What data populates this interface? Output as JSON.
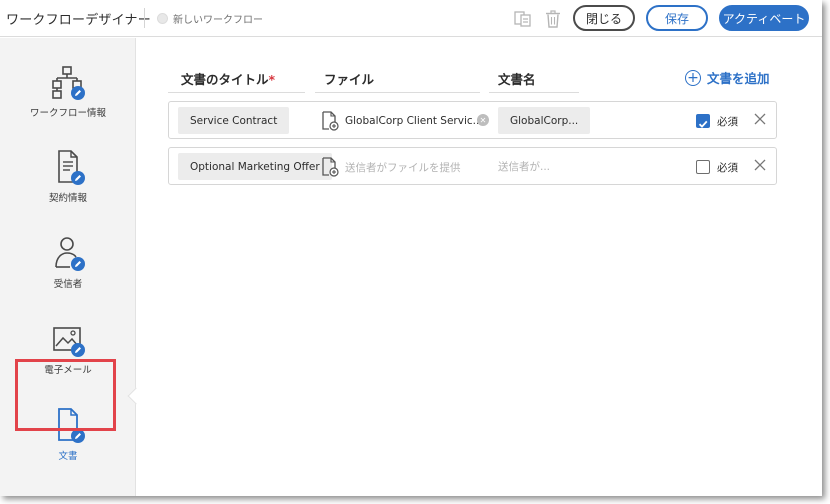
{
  "topbar": {
    "app_title": "ワークフローデザイナー",
    "workflow_name": "新しいワークフロー",
    "close_label": "閉じる",
    "save_label": "保存",
    "activate_label": "アクティベート"
  },
  "sidebar": {
    "items": [
      {
        "label": "ワークフロー情報",
        "icon": "workflow-icon"
      },
      {
        "label": "契約情報",
        "icon": "agreement-icon"
      },
      {
        "label": "受信者",
        "icon": "recipient-icon"
      },
      {
        "label": "電子メール",
        "icon": "email-icon"
      },
      {
        "label": "文書",
        "icon": "document-icon",
        "active": true
      }
    ]
  },
  "main": {
    "headers": {
      "title": "文書のタイトル",
      "required_mark": "*",
      "file": "ファイル",
      "doc_name": "文書名"
    },
    "add_document_label": "文書を追加",
    "rows": [
      {
        "title": "Service Contract",
        "file_name": "GlobalCorp Client Servic...",
        "doc_name": "GlobalCorp...",
        "required": true,
        "required_label": "必須"
      },
      {
        "title": "Optional Marketing Offer",
        "file_placeholder": "送信者がファイルを提供",
        "doc_name_placeholder": "送信者が...",
        "required": false,
        "required_label": "必須"
      }
    ]
  },
  "colors": {
    "accent": "#2d71c7",
    "highlight": "#e2434a",
    "required_star": "#d7373f"
  }
}
